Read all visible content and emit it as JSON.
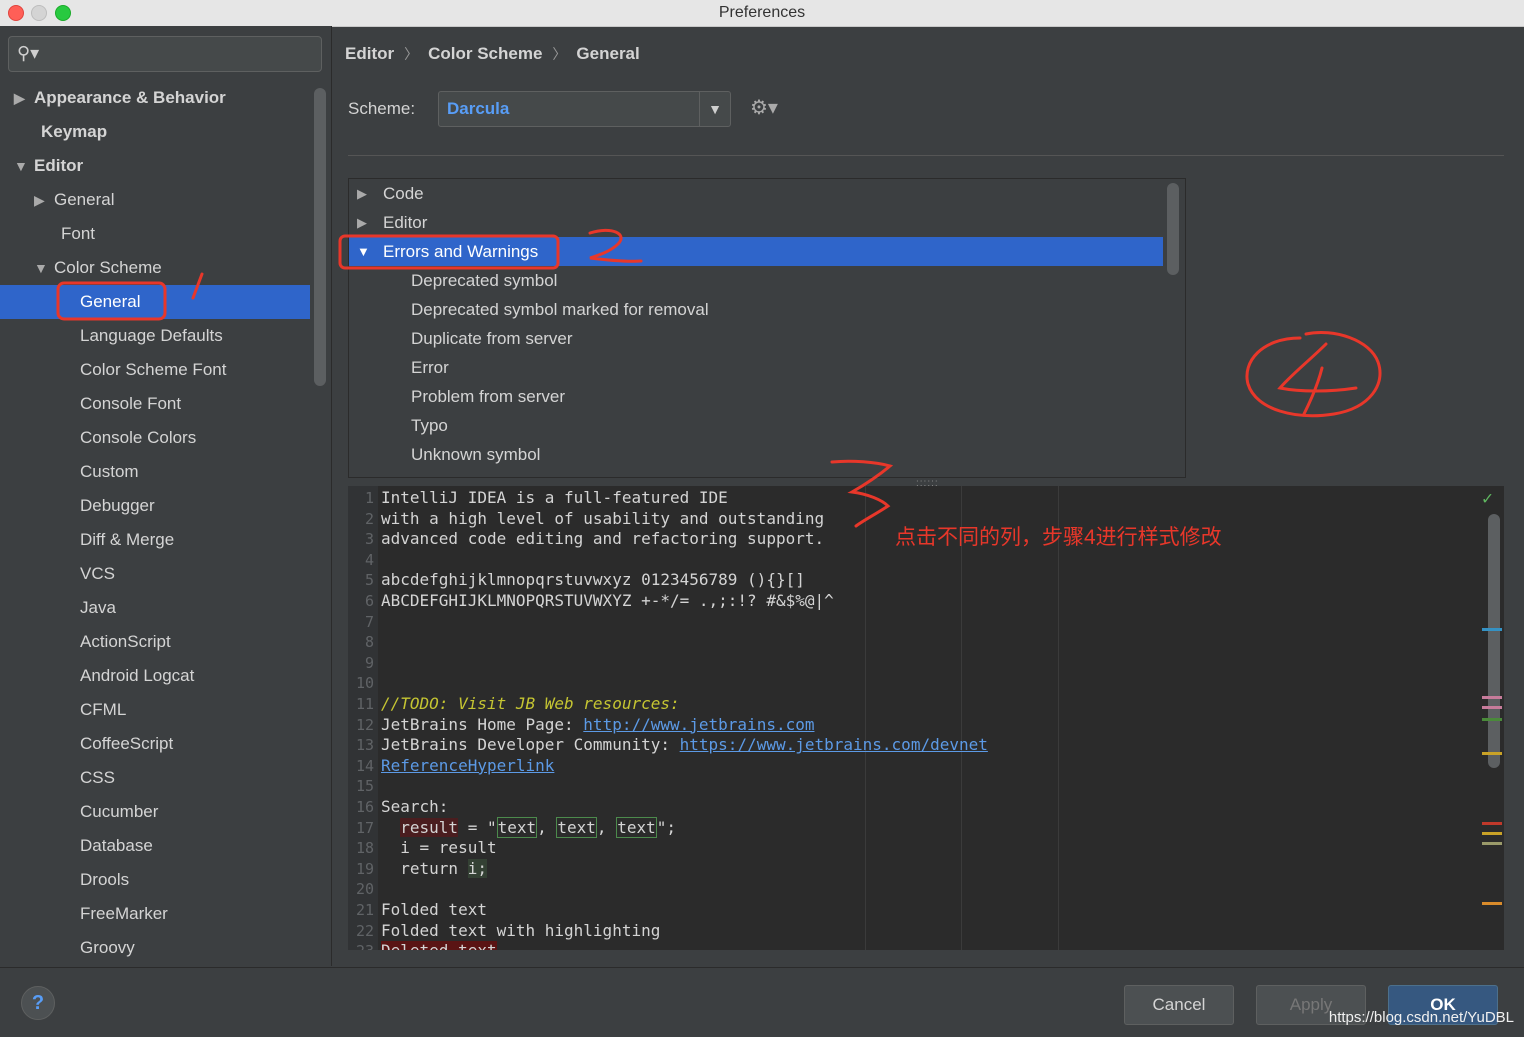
{
  "window": {
    "title": "Preferences"
  },
  "sidebar": {
    "items": [
      {
        "label": "Appearance & Behavior",
        "arrow": "▶"
      },
      {
        "label": "Keymap",
        "arrow": ""
      },
      {
        "label": "Editor",
        "arrow": "▼"
      },
      {
        "label": "General",
        "arrow": "▶"
      },
      {
        "label": "Font",
        "arrow": ""
      },
      {
        "label": "Color Scheme",
        "arrow": "▼"
      },
      {
        "label": "General",
        "arrow": ""
      },
      {
        "label": "Language Defaults",
        "arrow": ""
      },
      {
        "label": "Color Scheme Font",
        "arrow": ""
      },
      {
        "label": "Console Font",
        "arrow": ""
      },
      {
        "label": "Console Colors",
        "arrow": ""
      },
      {
        "label": "Custom",
        "arrow": ""
      },
      {
        "label": "Debugger",
        "arrow": ""
      },
      {
        "label": "Diff & Merge",
        "arrow": ""
      },
      {
        "label": "VCS",
        "arrow": ""
      },
      {
        "label": "Java",
        "arrow": ""
      },
      {
        "label": "ActionScript",
        "arrow": ""
      },
      {
        "label": "Android Logcat",
        "arrow": ""
      },
      {
        "label": "CFML",
        "arrow": ""
      },
      {
        "label": "CoffeeScript",
        "arrow": ""
      },
      {
        "label": "CSS",
        "arrow": ""
      },
      {
        "label": "Cucumber",
        "arrow": ""
      },
      {
        "label": "Database",
        "arrow": ""
      },
      {
        "label": "Drools",
        "arrow": ""
      },
      {
        "label": "FreeMarker",
        "arrow": ""
      },
      {
        "label": "Groovy",
        "arrow": ""
      }
    ]
  },
  "breadcrumb": {
    "items": [
      "Editor",
      "Color Scheme",
      "General"
    ],
    "separator": "〉"
  },
  "scheme": {
    "label": "Scheme:",
    "value": "Darcula",
    "dropdown": "▼",
    "gear": "⚙▾"
  },
  "categories": {
    "rows": [
      {
        "label": "Code",
        "arrow": "▶"
      },
      {
        "label": "Editor",
        "arrow": "▶"
      },
      {
        "label": "Errors and Warnings",
        "arrow": "▼"
      },
      {
        "label": "Deprecated symbol",
        "arrow": ""
      },
      {
        "label": "Deprecated symbol marked for removal",
        "arrow": ""
      },
      {
        "label": "Duplicate from server",
        "arrow": ""
      },
      {
        "label": "Error",
        "arrow": ""
      },
      {
        "label": "Problem from server",
        "arrow": ""
      },
      {
        "label": "Typo",
        "arrow": ""
      },
      {
        "label": "Unknown symbol",
        "arrow": ""
      }
    ]
  },
  "editor": {
    "line_numbers": [
      "1",
      "2",
      "3",
      "4",
      "5",
      "6",
      "7",
      "8",
      "9",
      "10",
      "11",
      "12",
      "13",
      "14",
      "15",
      "16",
      "17",
      "18",
      "19",
      "20",
      "21",
      "22",
      "23"
    ],
    "l1": "IntelliJ IDEA is a full-featured IDE",
    "l2": "with a high level of usability and outstanding",
    "l3": "advanced code editing and refactoring support.",
    "l5": "abcdefghijklmnopqrstuvwxyz 0123456789 (){}[]",
    "l6": "ABCDEFGHIJKLMNOPQRSTUVWXYZ +-*/= .,;:!? #&$%@|^",
    "l11": "//TODO: Visit JB Web resources:",
    "l12_label": "JetBrains Home Page: ",
    "l12_link": "http://www.jetbrains.com",
    "l13_label": "JetBrains Developer Community: ",
    "l13_link": "https://www.jetbrains.com/devnet",
    "l14_link": "ReferenceHyperlink",
    "l16": "Search:",
    "l17_a": "  ",
    "l17_result": "result",
    "l17_b": " = \"",
    "l17_t1": "text",
    "l17_c": ", ",
    "l17_t2": "text",
    "l17_d": ", ",
    "l17_t3": "text",
    "l17_e": "\";",
    "l18": "  i = result",
    "l19_a": "  return ",
    "l19_i": "i;",
    "l21": "Folded text",
    "l22": "Folded text with highlighting",
    "l23": "Deleted text",
    "check_icon": "✓"
  },
  "footer": {
    "help": "?",
    "cancel": "Cancel",
    "apply": "Apply",
    "ok": "OK"
  },
  "annotations": {
    "note": "点击不同的列，步骤4进行样式修改",
    "color": "#e8372a"
  },
  "watermark": "https://blog.csdn.net/YuDBL"
}
